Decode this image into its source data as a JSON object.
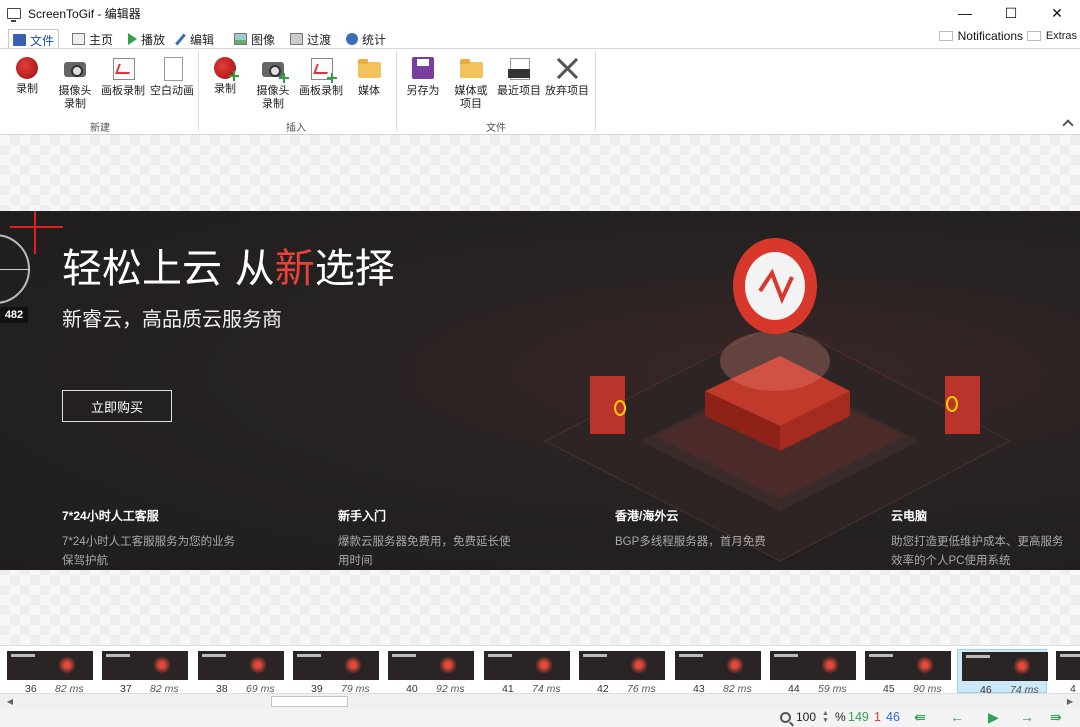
{
  "window": {
    "title": "ScreenToGif - 编辑器",
    "minimize": "—",
    "maximize": "☐",
    "close": "✕"
  },
  "tabs": [
    {
      "label": "文件",
      "icon": "save-icon",
      "active": true
    },
    {
      "label": "主页",
      "icon": "home-icon"
    },
    {
      "label": "播放",
      "icon": "play-icon"
    },
    {
      "label": "编辑",
      "icon": "pencil-icon"
    },
    {
      "label": "图像",
      "icon": "image-icon"
    },
    {
      "label": "过渡",
      "icon": "transition-icon"
    },
    {
      "label": "统计",
      "icon": "info-icon"
    }
  ],
  "notifications_label": "Notifications",
  "extras_label": "Extras",
  "ribbon": {
    "new_group": {
      "label": "新建",
      "record": "录制",
      "webcam": "摄像头录制",
      "board": "画板录制",
      "blank": "空白动画"
    },
    "insert_group": {
      "label": "插入",
      "record": "录制",
      "webcam": "摄像头录制",
      "board": "画板录制",
      "media": "媒体"
    },
    "file_group": {
      "label": "文件",
      "save_as": "另存为",
      "media_or_project": "媒体或项目",
      "recent": "最近项目",
      "discard": "放弃项目"
    }
  },
  "banner": {
    "title_part1": "轻松上云 从",
    "title_highlight": "新",
    "title_part2": "选择",
    "subtitle": "新睿云，高品质云服务商",
    "buy_button": "立即购买",
    "features": [
      {
        "title": "7*24小时人工客服",
        "desc": "7*24小时人工客服服务为您的业务保驾护航"
      },
      {
        "title": "新手入门",
        "desc": "爆款云服务器免费用，免费延长使用时间"
      },
      {
        "title": "香港/海外云",
        "desc": "BGP多线程服务器，首月免费"
      },
      {
        "title": "云电脑",
        "desc": "助您打造更低维护成本、更高服务效率的个人PC使用系统"
      }
    ],
    "gauge_value": "482"
  },
  "frames": [
    {
      "num": "36",
      "ms": "82 ms"
    },
    {
      "num": "37",
      "ms": "82 ms"
    },
    {
      "num": "38",
      "ms": "69 ms"
    },
    {
      "num": "39",
      "ms": "79 ms"
    },
    {
      "num": "40",
      "ms": "92 ms"
    },
    {
      "num": "41",
      "ms": "74 ms"
    },
    {
      "num": "42",
      "ms": "76 ms"
    },
    {
      "num": "43",
      "ms": "82 ms"
    },
    {
      "num": "44",
      "ms": "59 ms"
    },
    {
      "num": "45",
      "ms": "90 ms"
    },
    {
      "num": "46",
      "ms": "74 ms",
      "selected": true
    },
    {
      "num": "4",
      "ms": ""
    }
  ],
  "status": {
    "zoom": "100",
    "zoom_unit": "%",
    "frame_count": "149",
    "selected_count": "1",
    "current_frame": "46",
    "colors": {
      "count": "#2ea34f",
      "selected": "#d83b2b",
      "current": "#2b6dd6"
    }
  }
}
